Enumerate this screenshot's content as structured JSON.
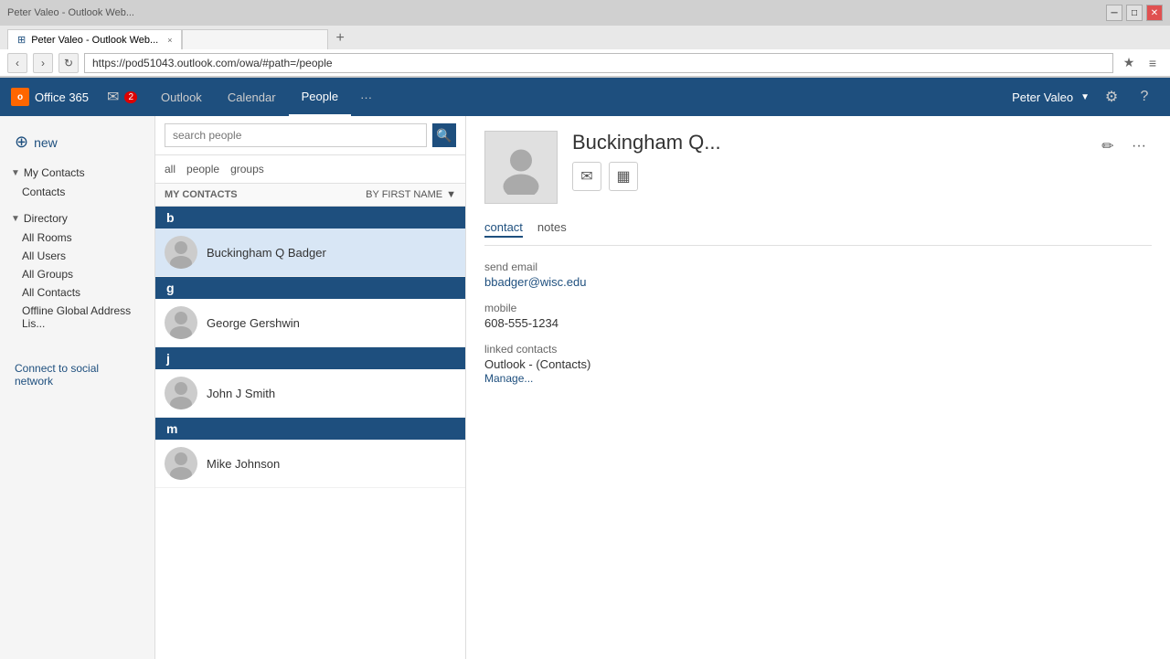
{
  "browser": {
    "tab_title": "Peter Valeo - Outlook Web...",
    "url": "https://pod51043.outlook.com/owa/#path=/people",
    "tab_close": "×",
    "nav_back": "‹",
    "nav_forward": "›",
    "nav_refresh": "↻",
    "star_icon": "★",
    "menu_icon": "≡"
  },
  "topnav": {
    "logo_text": "Office 365",
    "logo_abbr": "o",
    "mail_count": "2",
    "links": [
      {
        "label": "Outlook",
        "active": false
      },
      {
        "label": "Calendar",
        "active": false
      },
      {
        "label": "People",
        "active": true
      },
      {
        "label": "···",
        "active": false
      }
    ],
    "user_name": "Peter Valeo",
    "settings_icon": "⚙",
    "help_icon": "?"
  },
  "sidebar": {
    "new_label": "new",
    "sections": [
      {
        "title": "My Contacts",
        "expanded": true,
        "items": [
          {
            "label": "Contacts",
            "active": false
          }
        ]
      },
      {
        "title": "Directory",
        "expanded": true,
        "items": [
          {
            "label": "All Rooms",
            "active": false
          },
          {
            "label": "All Users",
            "active": false
          },
          {
            "label": "All Groups",
            "active": false
          },
          {
            "label": "All Contacts",
            "active": false
          },
          {
            "label": "Offline Global Address Lis...",
            "active": false
          }
        ]
      }
    ],
    "connect_label": "Connect to social network"
  },
  "contact_list": {
    "search_placeholder": "search people",
    "filter_tabs": [
      {
        "label": "all",
        "active": false
      },
      {
        "label": "people",
        "active": false
      },
      {
        "label": "groups",
        "active": false
      }
    ],
    "header_title": "MY CONTACTS",
    "sort_label": "BY FIRST NAME",
    "groups": [
      {
        "letter": "b",
        "contacts": [
          {
            "name": "Buckingham Q Badger",
            "selected": true
          }
        ]
      },
      {
        "letter": "g",
        "contacts": [
          {
            "name": "George Gershwin",
            "selected": false
          }
        ]
      },
      {
        "letter": "j",
        "contacts": [
          {
            "name": "John J Smith",
            "selected": false
          }
        ]
      },
      {
        "letter": "m",
        "contacts": [
          {
            "name": "Mike Johnson",
            "selected": false
          }
        ]
      }
    ]
  },
  "detail": {
    "name": "Buckingham Q...",
    "edit_icon": "✏",
    "more_icon": "···",
    "email_icon": "✉",
    "calendar_icon": "▦",
    "tabs": [
      {
        "label": "contact",
        "active": true
      },
      {
        "label": "notes",
        "active": false
      }
    ],
    "fields": [
      {
        "label": "send email",
        "value": "bbadger@wisc.edu",
        "type": "link"
      },
      {
        "label": "mobile",
        "value": "608-555-1234",
        "type": "text"
      },
      {
        "label": "linked contacts",
        "value": "Outlook - (Contacts)",
        "type": "text"
      }
    ],
    "manage_label": "Manage..."
  }
}
